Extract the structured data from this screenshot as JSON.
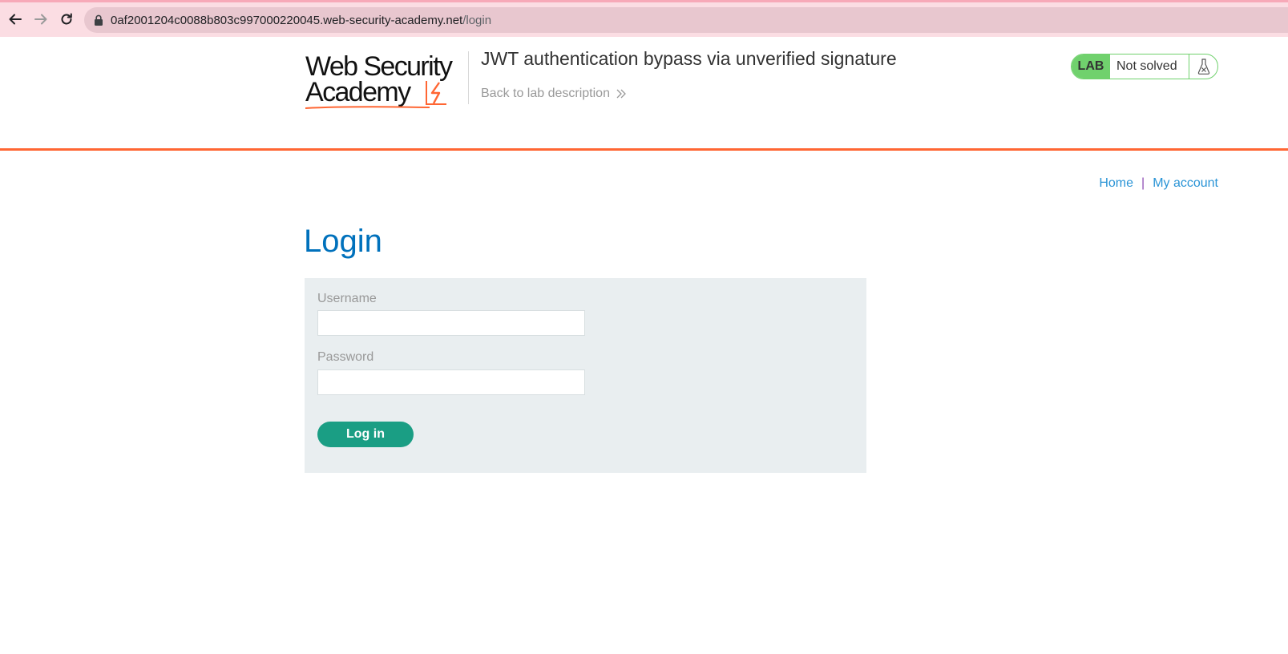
{
  "browser": {
    "url_host": "0af2001204c0088b803c997000220045.web-security-academy.net",
    "url_path": "/login",
    "back_icon": "arrow-left-icon",
    "forward_icon": "arrow-right-icon",
    "reload_icon": "reload-icon",
    "lock_icon": "lock-icon"
  },
  "header": {
    "logo_line1": "Web Security",
    "logo_line2": "Academy",
    "lab_title": "JWT authentication bypass via unverified signature",
    "back_link": "Back to lab description",
    "lab_badge": "LAB",
    "lab_status": "Not solved",
    "status_icon": "flask-icon"
  },
  "nav": {
    "home": "Home",
    "separator": "|",
    "my_account": "My account"
  },
  "login": {
    "title": "Login",
    "username_label": "Username",
    "username_value": "",
    "password_label": "Password",
    "password_value": "",
    "submit_label": "Log in"
  },
  "colors": {
    "accent_orange": "#ff6633",
    "title_blue": "#0071bc",
    "link_blue": "#2a94d6",
    "button_green": "#1a9e84",
    "lab_green": "#70d16d",
    "panel_bg": "#e9eef0",
    "browser_bar": "#fbdde3"
  }
}
